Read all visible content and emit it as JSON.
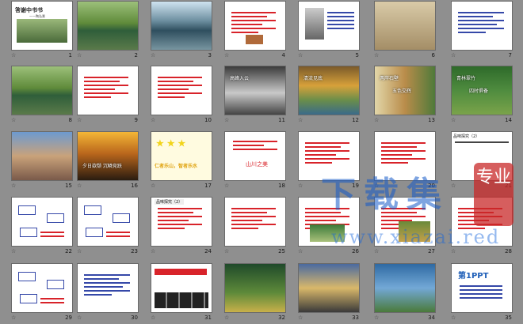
{
  "slides": [
    {
      "n": "1",
      "kind": "title",
      "title": "答谢中书书",
      "sub": "——陶弘景"
    },
    {
      "n": "2",
      "kind": "lake"
    },
    {
      "n": "3",
      "kind": "lake2"
    },
    {
      "n": "4",
      "kind": "text-house"
    },
    {
      "n": "5",
      "kind": "portrait"
    },
    {
      "n": "6",
      "kind": "painting"
    },
    {
      "n": "7",
      "kind": "text-blue"
    },
    {
      "n": "8",
      "kind": "lake"
    },
    {
      "n": "9",
      "kind": "text-red"
    },
    {
      "n": "10",
      "kind": "text-red"
    },
    {
      "n": "11",
      "kind": "cliff",
      "caption": "高峰入云"
    },
    {
      "n": "12",
      "kind": "forest",
      "caption": "清流见底"
    },
    {
      "n": "13",
      "kind": "rocks",
      "caption": "两岸石壁",
      "caption2": "五色交辉"
    },
    {
      "n": "14",
      "kind": "bamboo",
      "caption": "青林翠竹",
      "caption2": "四时俱备"
    },
    {
      "n": "15",
      "kind": "cliff-bright"
    },
    {
      "n": "16",
      "kind": "sunset",
      "caption": "夕日欲颓 沉鳞竞跃"
    },
    {
      "n": "17",
      "kind": "yellow-text",
      "caption": "仁者乐山，智者乐水"
    },
    {
      "n": "18",
      "kind": "white-text",
      "caption": "山川之美"
    },
    {
      "n": "19",
      "kind": "text-red"
    },
    {
      "n": "20",
      "kind": "text-red"
    },
    {
      "n": "21",
      "kind": "blank-header",
      "header": "品味探究（2）"
    },
    {
      "n": "22",
      "kind": "diagram"
    },
    {
      "n": "23",
      "kind": "diagram2"
    },
    {
      "n": "24",
      "kind": "text-red",
      "header": "品味探究（2）"
    },
    {
      "n": "25",
      "kind": "text-red"
    },
    {
      "n": "26",
      "kind": "text-photo"
    },
    {
      "n": "27",
      "kind": "text-photo2"
    },
    {
      "n": "28",
      "kind": "text-red"
    },
    {
      "n": "29",
      "kind": "diagram3"
    },
    {
      "n": "30",
      "kind": "text-blue"
    },
    {
      "n": "31",
      "kind": "film"
    },
    {
      "n": "32",
      "kind": "green-scene"
    },
    {
      "n": "33",
      "kind": "sky-scene"
    },
    {
      "n": "34",
      "kind": "blue-scene"
    },
    {
      "n": "35",
      "kind": "ad",
      "caption": "第1PPT"
    }
  ],
  "watermark": {
    "main": "下载集",
    "url": "www.xiazai.red",
    "badge": "专业"
  },
  "star_glyph": "☆"
}
